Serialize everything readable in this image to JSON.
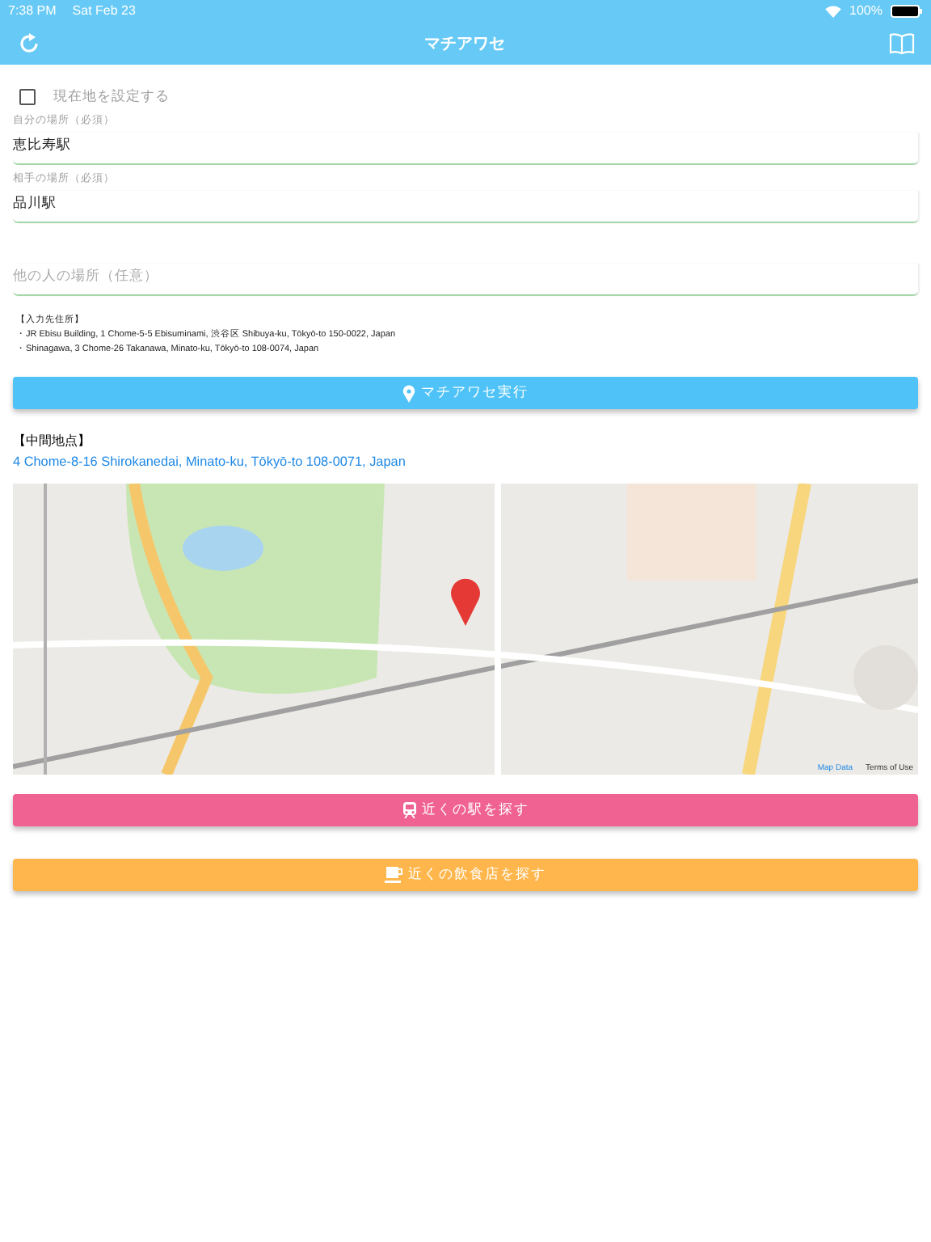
{
  "status_bar": {
    "time": "7:38 PM",
    "date": "Sat Feb 23",
    "battery": "100%"
  },
  "nav_bar": {
    "title": "マチアワセ"
  },
  "current_location": {
    "label": "現在地を設定する",
    "checked": false
  },
  "fields": [
    {
      "label": "自分の場所（必須）",
      "value": "恵比寿駅"
    },
    {
      "label": "相手の場所（必須）",
      "value": "品川駅"
    },
    {
      "placeholder": "他の人の場所（任意）"
    }
  ],
  "input_addresses": {
    "heading": "【入力先住所】",
    "lines": [
      "・JR Ebisu Building, 1 Chome-5-5 Ebisuminami, 渋谷区 Shibuya-ku, Tōkyō-to 150-0022, Japan",
      "・Shinagawa, 3 Chome-26 Takanawa, Minato-ku, Tōkyō-to 108-0074, Japan"
    ]
  },
  "run_button": {
    "label": "マチアワセ実行"
  },
  "midpoint": {
    "heading": "【中間地点】",
    "address": "4 Chome-8-16 Shirokanedai, Minato-ku, Tōkyō-to 108-0071, Japan"
  },
  "map": {
    "kind": "picture",
    "links": [
      "Map Data",
      "Terms of Use"
    ]
  },
  "actions": [
    {
      "kind": "station",
      "label": "近くの駅を探す"
    },
    {
      "kind": "restaurant",
      "label": "近くの飲食店を探す"
    }
  ]
}
